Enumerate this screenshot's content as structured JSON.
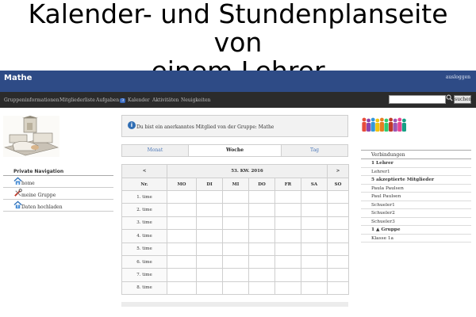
{
  "caption": {
    "line1": "Kalender- und Stundenplanseite von",
    "line2": "einem Lehrer"
  },
  "header": {
    "brand": "Mathe",
    "logout": "ausloggen"
  },
  "nav": {
    "items": [
      "Gruppeninformationen",
      "Mitgliederliste",
      "Aufgaben",
      "Kalender",
      "Aktivitäten",
      "Neuigkeiten"
    ],
    "badge": "3",
    "search_placeholder": "",
    "search_button": "suchen"
  },
  "private_nav": {
    "title": "Private Navigation",
    "items": [
      {
        "label": "home",
        "icon": "house-icon"
      },
      {
        "label": "meine Gruppe",
        "icon": "tools-icon"
      },
      {
        "label": "Daten hochladen",
        "icon": "upload-icon"
      }
    ]
  },
  "info": {
    "icon_letter": "i",
    "text": "Du bist ein anerkanntes Mitglied von der Gruppe: Mathe"
  },
  "views": {
    "month": "Monat",
    "week": "Woche",
    "day": "Tag"
  },
  "calendar": {
    "prev": "<",
    "next": ">",
    "week_label": "53. KW. 2016",
    "nr_header": "Nr.",
    "days": [
      "MO",
      "DI",
      "MI",
      "DO",
      "FR",
      "SA",
      "SO"
    ],
    "rows": [
      "1. time",
      "2. time",
      "3. time",
      "4. time",
      "5. time",
      "6. time",
      "7. time",
      "8. time"
    ]
  },
  "connections": {
    "header": "Verbindungen",
    "rows": [
      {
        "text": "1 Lehrer",
        "bold": true
      },
      {
        "text": "Lehrer1",
        "bold": false
      },
      {
        "text": "5 akzeptierte Mitglieder",
        "bold": true
      },
      {
        "text": "Paula Paulsen",
        "bold": false
      },
      {
        "text": "Paul Paulsen",
        "bold": false
      },
      {
        "text": "Schueler1",
        "bold": false
      },
      {
        "text": "Schueler2",
        "bold": false
      },
      {
        "text": "Schueler3",
        "bold": false
      },
      {
        "text": "1 ▲ Gruppe",
        "bold": true
      },
      {
        "text": "Klasse 1a",
        "bold": false
      }
    ]
  },
  "colors": {
    "header_bg": "#2e4b86",
    "nav_bg": "#2b2b2b",
    "link": "#4a76b8",
    "info_icon": "#2f6db3"
  }
}
